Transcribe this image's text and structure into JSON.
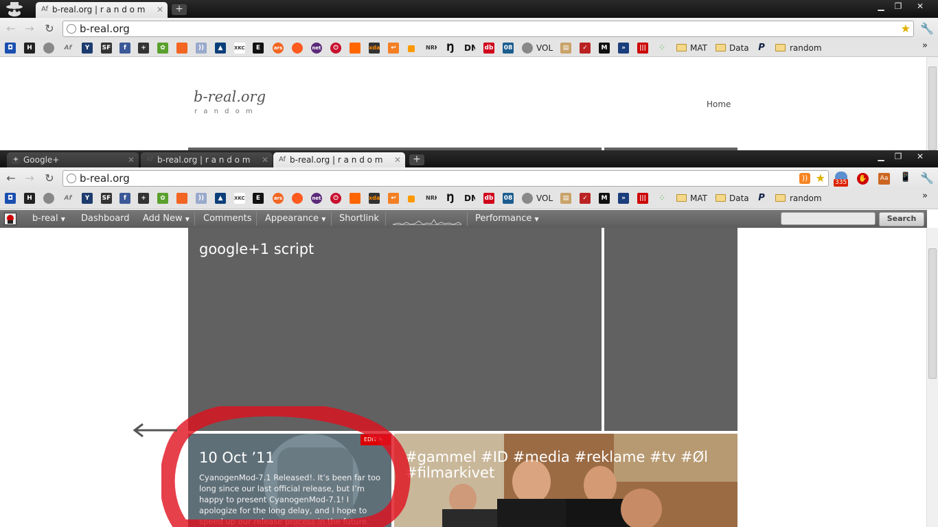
{
  "window1": {
    "tab": "b-real.org | r a n d o m",
    "url": "b-real.org"
  },
  "window2": {
    "tabs": [
      "Google+",
      "b-real.org | r a n d o m",
      "b-real.org | r a n d o m"
    ],
    "url": "b-real.org",
    "extension_badge": "335"
  },
  "bookmarks": {
    "vol": "VOL",
    "folders": [
      "MAT",
      "Data",
      "random"
    ]
  },
  "site": {
    "title": "b-real.org",
    "tagline": "r a n d o m",
    "nav_home": "Home"
  },
  "adminbar": {
    "site": "b-real",
    "items": [
      "Dashboard",
      "Add New",
      "Comments",
      "Appearance",
      "Shortlink",
      "Performance"
    ],
    "search_button": "Search",
    "search_value": ""
  },
  "posts": {
    "featured_title": "google+1 script",
    "post1_date": "10 Oct ’11",
    "post1_edit": "EDIT",
    "post1_excerpt": "CyanogenMod-7.1 Released!.   It’s been far too long since our last official release, but I’m happy to present CyanogenMod-7.1! I apologize for the long delay, and I hope to speed up our release process in the future.",
    "post2_title": "#gammel #ID #media #reklame #tv #Øl #filmarkivet"
  },
  "colors": {
    "admin_bar": "#5d5d5d",
    "panel": "#616161",
    "highlight_circle": "#e0101e",
    "rss": "#f78422"
  }
}
